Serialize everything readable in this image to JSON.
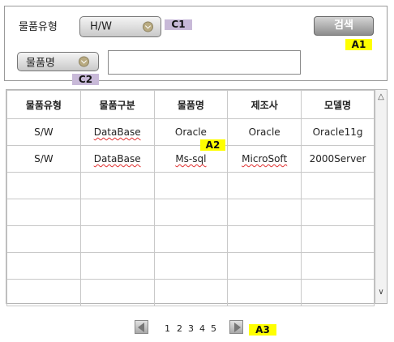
{
  "search": {
    "product_type_label": "물품유형",
    "product_type_value": "H/W",
    "name_selector_value": "물품명",
    "name_input_value": "",
    "search_button_label": "검색"
  },
  "tags": {
    "c1": "C1",
    "c2": "C2",
    "a1": "A1",
    "a2": "A2",
    "a3": "A3"
  },
  "grid": {
    "columns": [
      "물품유형",
      "물품구분",
      "물품명",
      "제조사",
      "모델명"
    ],
    "rows": [
      [
        "S/W",
        "DataBase",
        "Oracle",
        "Oracle",
        "Oracle11g"
      ],
      [
        "S/W",
        "DataBase",
        "Ms-sql",
        "MicroSoft",
        "2000Server"
      ]
    ],
    "empty_row_count": 5
  },
  "pagination": {
    "pages": [
      "1",
      "2",
      "3",
      "4",
      "5"
    ]
  },
  "icons": {
    "combo_chevron": "chevron-down-icon",
    "prev": "triangle-left-icon",
    "next": "triangle-right-icon"
  },
  "colors": {
    "tag_purple": "#c8b9d8",
    "tag_yellow": "#ffff00",
    "chevron": "#b9ab82"
  }
}
